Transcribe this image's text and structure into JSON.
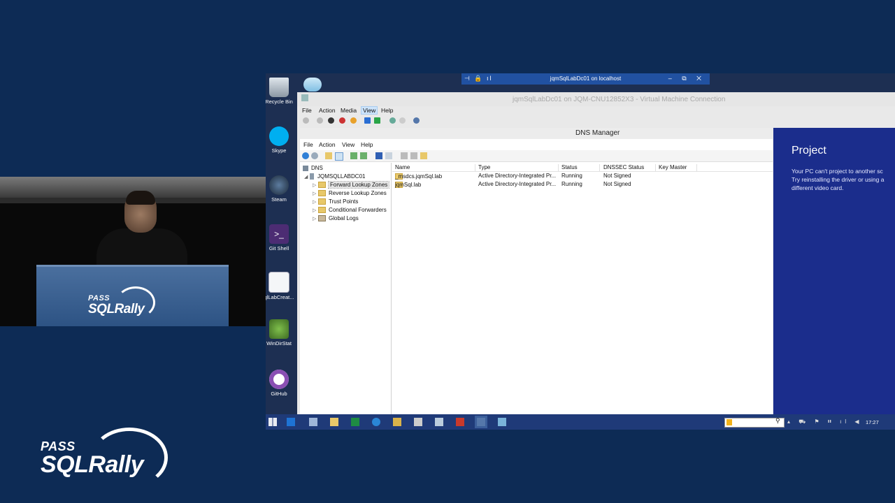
{
  "rdp_bar": {
    "title": "jqmSqlLabDc01 on localhost",
    "left_icons": "⊣ 🔒 ıl",
    "right_controls": "‒ ⧉ ✕"
  },
  "vm_connection": {
    "title": "jqmSqlLabDc01 on JQM-CNU12852X3 - Virtual Machine Connection",
    "menu": [
      "File",
      "Action",
      "Media",
      "View",
      "Help"
    ]
  },
  "dns_manager": {
    "title": "DNS Manager",
    "menu": [
      "File",
      "Action",
      "View",
      "Help"
    ],
    "tree": {
      "root": "DNS",
      "server": "JQMSQLLABDC01",
      "children": [
        "Forward Lookup Zones",
        "Reverse Lookup Zones",
        "Trust Points",
        "Conditional Forwarders",
        "Global Logs"
      ]
    },
    "columns": [
      "Name",
      "Type",
      "Status",
      "DNSSEC Status",
      "Key Master"
    ],
    "rows": [
      {
        "name": "_msdcs.jqmSql.lab",
        "type": "Active Directory-Integrated Pr...",
        "status": "Running",
        "dnssec": "Not Signed"
      },
      {
        "name": "jqmSql.lab",
        "type": "Active Directory-Integrated Pr...",
        "status": "Running",
        "dnssec": "Not Signed"
      }
    ]
  },
  "project_panel": {
    "title": "Project",
    "message": "Your PC can't project to another sc\nTry reinstalling the driver or using a\ndifferent video card."
  },
  "desktop_icons": [
    {
      "label": "Recycle Bin",
      "icon": "recycle-bin-icon"
    },
    {
      "label": "Skype",
      "icon": "skype-icon"
    },
    {
      "label": "Steam",
      "icon": "steam-icon"
    },
    {
      "label": "Git Shell",
      "icon": "git-shell-icon"
    },
    {
      "label": "qlLabCreat...",
      "icon": "script-file-icon"
    },
    {
      "label": "WinDirStat",
      "icon": "windirstat-icon"
    },
    {
      "label": "GitHub",
      "icon": "github-icon"
    }
  ],
  "taskbar": {
    "time": "17:27",
    "tray": "▴ ⛟ ⚑ ⏸ ıl ◀"
  },
  "branding": {
    "pass": "PASS",
    "sqlrally": "SQLRally"
  },
  "colors": {
    "slide_bg": "#0d2b55",
    "project_bg": "#1b2d8c",
    "rdp_bar": "#2151a1"
  }
}
